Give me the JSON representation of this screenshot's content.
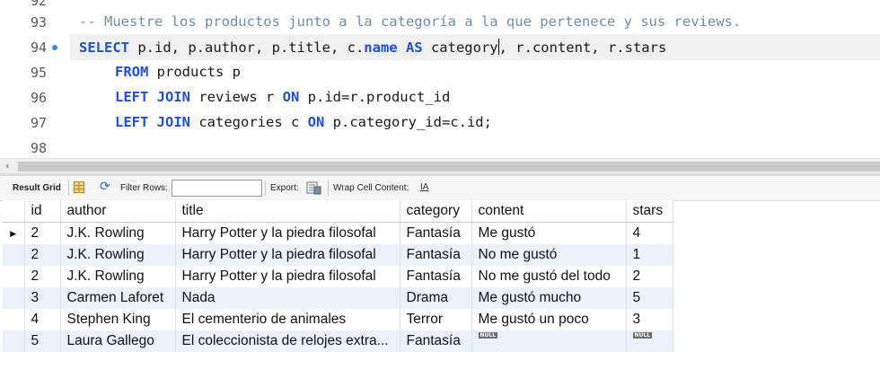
{
  "editor": {
    "lines": [
      {
        "num": "92",
        "code": ""
      },
      {
        "num": "93",
        "comment": "-- Muestre los productos junto a la categoría a la que pertenece y sus reviews."
      },
      {
        "num": "94",
        "current": true
      },
      {
        "num": "95"
      },
      {
        "num": "96"
      },
      {
        "num": "97"
      },
      {
        "num": "98"
      }
    ],
    "l94": {
      "kw1": "SELECT",
      "t1": " p.id, p.author, p.title, c.",
      "kw2": "name",
      "t2": " ",
      "kw3": "AS",
      "t3": " category",
      "t4": ", r.content, r.stars"
    },
    "l95": {
      "kw1": "FROM",
      "t1": " products p"
    },
    "l96": {
      "kw1": "LEFT JOIN",
      "t1": " reviews r ",
      "kw2": "ON",
      "t2": " p.id=r.product_id"
    },
    "l97": {
      "kw1": "LEFT JOIN",
      "t1": " categories c ",
      "kw2": "ON",
      "t2": " p.category_id=c.id;"
    }
  },
  "toolbar": {
    "result_grid": "Result Grid",
    "filter_rows": "Filter Rows:",
    "filter_value": "",
    "export": "Export:",
    "wrap": "Wrap Cell Content:",
    "wrap_icon": "IA"
  },
  "grid": {
    "columns": [
      "id",
      "author",
      "title",
      "category",
      "content",
      "stars"
    ],
    "rows": [
      [
        "2",
        "J.K. Rowling",
        "Harry Potter y la piedra filosofal",
        "Fantasía",
        "Me gustó",
        "4"
      ],
      [
        "2",
        "J.K. Rowling",
        "Harry Potter y la piedra filosofal",
        "Fantasía",
        "No me gustó",
        "1"
      ],
      [
        "2",
        "J.K. Rowling",
        "Harry Potter y la piedra filosofal",
        "Fantasía",
        "No me gustó del todo",
        "2"
      ],
      [
        "3",
        "Carmen Laforet",
        "Nada",
        "Drama",
        "Me gustó mucho",
        "5"
      ],
      [
        "4",
        "Stephen King",
        "El cementerio de animales",
        "Terror",
        "Me gustó un poco",
        "3"
      ],
      [
        "5",
        "Laura Gallego",
        "El coleccionista de relojes extra...",
        "Fantasía",
        "NULL",
        "NULL"
      ]
    ],
    "current_row_marker": "▶"
  },
  "colors": {
    "keyword": "#1e50d8",
    "comment": "#6f8fa8",
    "alt_row": "#eaf1fb",
    "marker_dot": "#3c8dd6"
  }
}
